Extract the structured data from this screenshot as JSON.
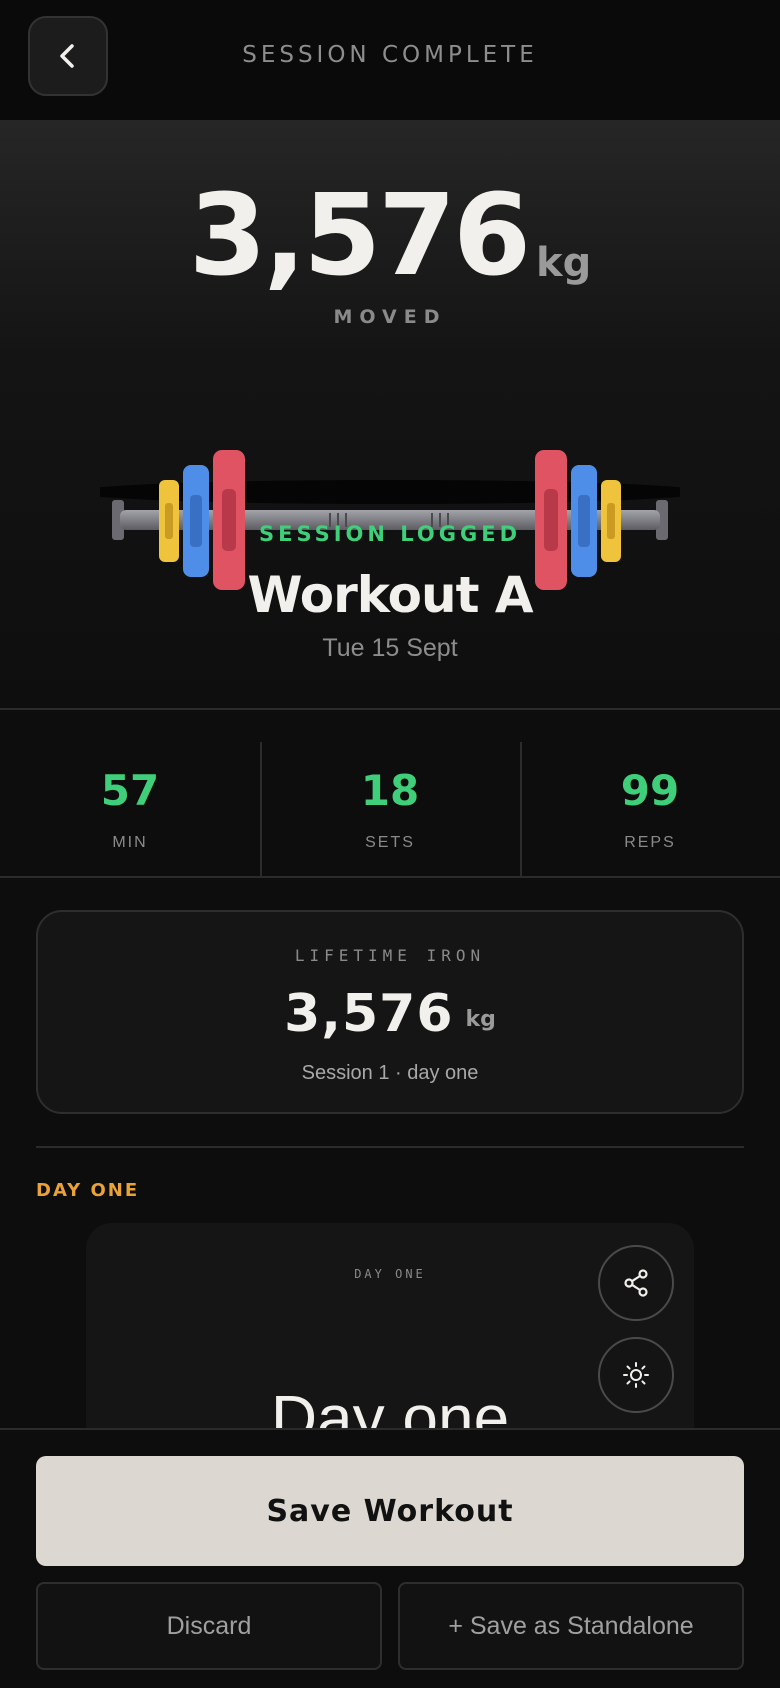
{
  "header": {
    "title": "SESSION COMPLETE",
    "back_icon": "chevron-left-icon"
  },
  "hero": {
    "total": "3,576",
    "unit": "kg",
    "moved_label": "MOVED",
    "logged_label": "SESSION LOGGED",
    "workout_name": "Workout A",
    "date": "Tue 15 Sept"
  },
  "stats": [
    {
      "value": "57",
      "label": "MIN"
    },
    {
      "value": "18",
      "label": "SETS"
    },
    {
      "value": "99",
      "label": "REPS"
    }
  ],
  "lifetime": {
    "title": "LIFETIME IRON",
    "value": "3,576",
    "unit": "kg",
    "subtitle": "Session 1 · day one"
  },
  "section_label": "DAY ONE",
  "day_card": {
    "label": "DAY ONE",
    "heading": "Day one",
    "share_icon": "share-icon",
    "theme_icon": "sun-icon"
  },
  "actions": {
    "save": "Save Workout",
    "discard": "Discard",
    "standalone": "+ Save as Standalone"
  },
  "colors": {
    "accent_green": "#3fcf7a",
    "accent_orange": "#e8a23a",
    "plate_red": "#e05363",
    "plate_blue": "#4f8ee8",
    "plate_yellow": "#f0c33c",
    "save_button": "#dcd7d1"
  }
}
